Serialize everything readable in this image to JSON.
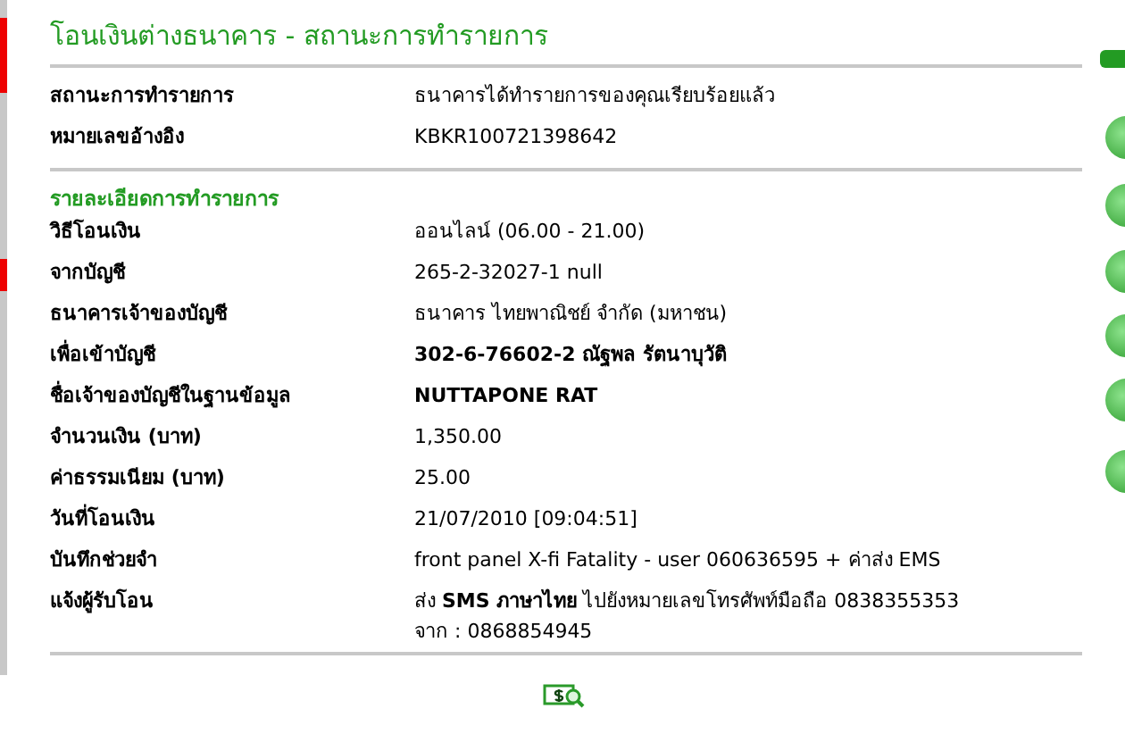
{
  "title": "โอนเงินต่างธนาคาร - สถานะการทำรายการ",
  "status_rows": [
    {
      "label": "สถานะการทำรายการ",
      "value": "ธนาคารได้ทำรายการของคุณเรียบร้อยแล้ว",
      "bold": false
    },
    {
      "label": "หมายเลขอ้างอิง",
      "value": "KBKR100721398642",
      "bold": false
    }
  ],
  "details_heading": "รายละเอียดการทำรายการ",
  "detail_rows": [
    {
      "label": "วิธีโอนเงิน",
      "lines": [
        "ออนไลน์ (06.00 - 21.00)"
      ],
      "bold": false
    },
    {
      "label": "จากบัญชี",
      "lines": [
        "265-2-32027-1 null"
      ],
      "bold": false
    },
    {
      "label": "ธนาคารเจ้าของบัญชี",
      "lines": [
        "ธนาคาร ไทยพาณิชย์ จำกัด (มหาชน)"
      ],
      "bold": false
    },
    {
      "label": "เพื่อเข้าบัญชี",
      "lines": [
        "302-6-76602-2 ณัฐพล รัตนาบุวัติ"
      ],
      "bold": true
    },
    {
      "label": "ชื่อเจ้าของบัญชีในฐานข้อมูล",
      "lines": [
        "NUTTAPONE RAT"
      ],
      "bold": true
    },
    {
      "label": "จำนวนเงิน (บาท)",
      "lines": [
        "1,350.00"
      ],
      "bold": false
    },
    {
      "label": "ค่าธรรมเนียม (บาท)",
      "lines": [
        "25.00"
      ],
      "bold": false
    },
    {
      "label": "วันที่โอนเงิน",
      "lines": [
        "21/07/2010 [09:04:51]"
      ],
      "bold": false
    },
    {
      "label": "บันทึกช่วยจำ",
      "lines": [
        "front panel X-fi Fatality - user 060636595 + ค่าส่ง EMS"
      ],
      "bold": false
    },
    {
      "label": "แจ้งผู้รับโอน",
      "lines": [
        "ส่ง **SMS ภาษาไทย** ไปยังหมายเลขโทรศัพท์มือถือ 0838355353",
        "จาก : 0868854945"
      ],
      "bold": false
    }
  ]
}
